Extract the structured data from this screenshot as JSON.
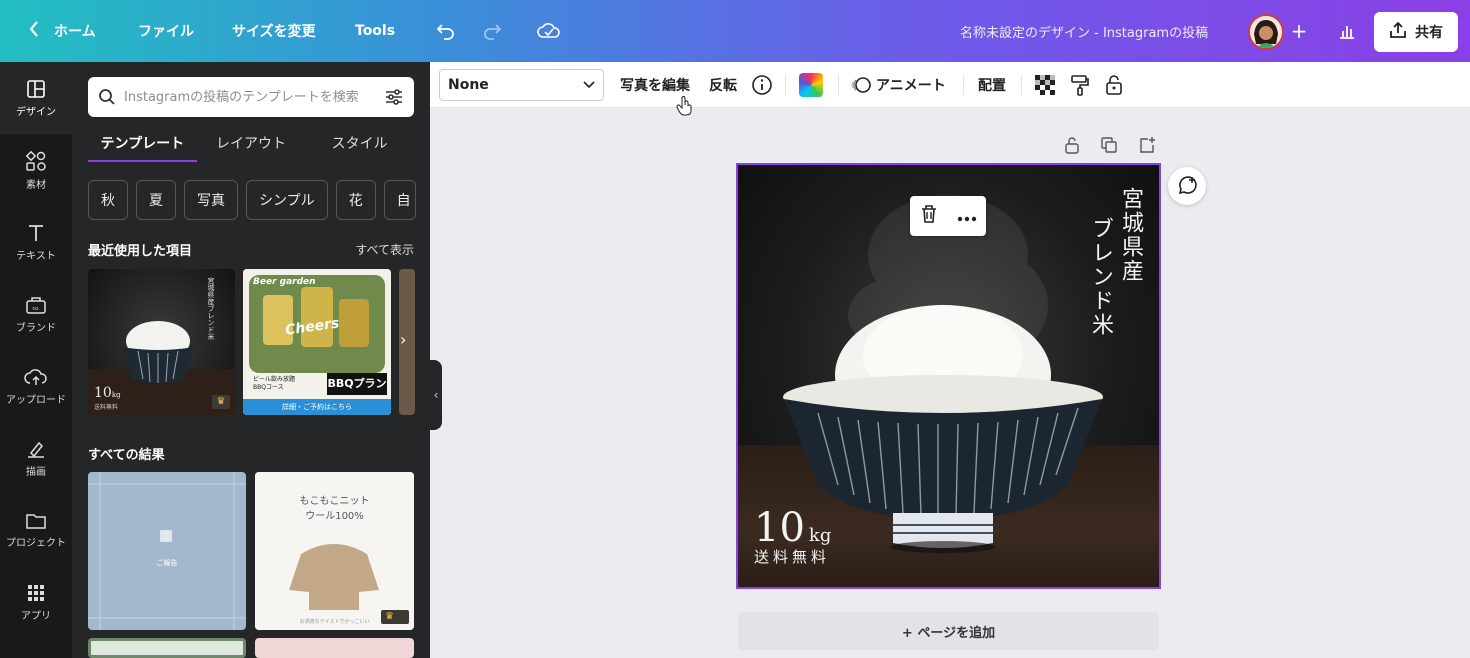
{
  "topbar": {
    "home": "ホーム",
    "file": "ファイル",
    "resize": "サイズを変更",
    "tools": "Tools",
    "doc_title": "名称未設定のデザイン - Instagramの投稿",
    "share": "共有",
    "gradient_start": "#22bfc2",
    "gradient_end": "#8b3fe6"
  },
  "rail": {
    "items": [
      {
        "label": "デザイン",
        "icon": "layout-icon"
      },
      {
        "label": "素材",
        "icon": "shapes-icon"
      },
      {
        "label": "テキスト",
        "icon": "text-icon"
      },
      {
        "label": "ブランド",
        "icon": "brand-icon"
      },
      {
        "label": "アップロード",
        "icon": "cloud-upload-icon"
      },
      {
        "label": "描画",
        "icon": "draw-icon"
      },
      {
        "label": "プロジェクト",
        "icon": "folder-icon"
      },
      {
        "label": "アプリ",
        "icon": "apps-icon"
      }
    ]
  },
  "panel": {
    "search_placeholder": "Instagramの投稿のテンプレートを検索",
    "tabs": [
      "テンプレート",
      "レイアウト",
      "スタイル"
    ],
    "chips": [
      "秋",
      "夏",
      "写真",
      "シンプル",
      "花",
      "自"
    ],
    "recent_title": "最近使用した項目",
    "see_all": "すべて表示",
    "results_title": "すべての結果",
    "thumb1_vertical": "宮城県産ブレンド米",
    "thumb1_weight": "10",
    "thumb1_unit": "kg",
    "thumb1_free": "送料無料",
    "thumb2_brand": "Beer garden",
    "thumb2_script": "Cheers",
    "thumb2_small1": "ビール飲み放題",
    "thumb2_small2": "BBQコース",
    "thumb2_plan": "BBQプラン",
    "thumb2_footer": "詳細・ご予約はこちら",
    "thumb3_label": "ご報告",
    "thumb4_line1": "もこもこニット",
    "thumb4_line2": "ウール100%",
    "thumb4_caption": "お洒落なテイストでかっこいい"
  },
  "ctxbar": {
    "filter": "None",
    "edit_photo": "写真を編集",
    "flip": "反転",
    "animate": "アニメート",
    "position": "配置"
  },
  "design": {
    "vertical_col1": "宮城県産",
    "vertical_col2": "ブレンド米",
    "weight": "10",
    "unit": "kg",
    "free": "送料無料",
    "add_page": "+ ページを追加",
    "selection_color": "#8b3fe6"
  }
}
